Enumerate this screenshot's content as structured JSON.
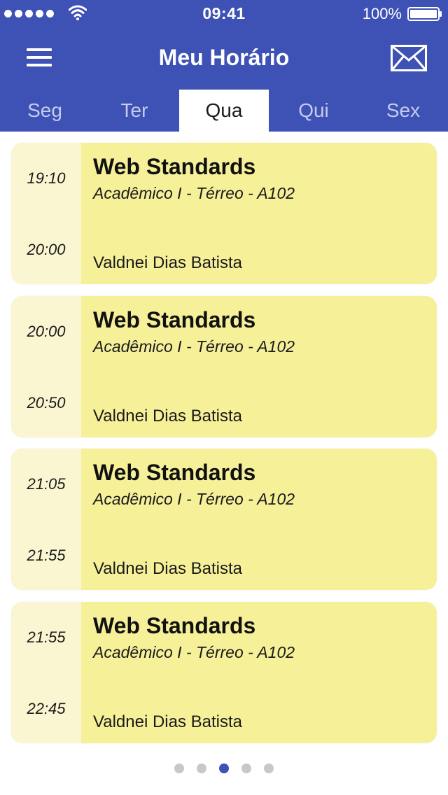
{
  "status_bar": {
    "time": "09:41",
    "battery": "100%"
  },
  "header": {
    "title": "Meu Horário",
    "menu_icon": "hamburger-menu-icon",
    "mail_icon": "envelope-icon"
  },
  "tabs": [
    {
      "label": "Seg",
      "active": false
    },
    {
      "label": "Ter",
      "active": false
    },
    {
      "label": "Qua",
      "active": true
    },
    {
      "label": "Qui",
      "active": false
    },
    {
      "label": "Sex",
      "active": false
    }
  ],
  "classes": [
    {
      "start": "19:10",
      "end": "20:00",
      "title": "Web Standards",
      "location": "Acadêmico I - Térreo - A102",
      "teacher": "Valdnei Dias Batista"
    },
    {
      "start": "20:00",
      "end": "20:50",
      "title": "Web Standards",
      "location": "Acadêmico I - Térreo - A102",
      "teacher": "Valdnei Dias Batista"
    },
    {
      "start": "21:05",
      "end": "21:55",
      "title": "Web Standards",
      "location": "Acadêmico I - Térreo - A102",
      "teacher": "Valdnei Dias Batista"
    },
    {
      "start": "21:55",
      "end": "22:45",
      "title": "Web Standards",
      "location": "Acadêmico I - Térreo - A102",
      "teacher": "Valdnei Dias Batista"
    }
  ],
  "pager": {
    "total": 5,
    "active_index": 2
  },
  "colors": {
    "header": "#3e51b5",
    "card": "#f6f099",
    "card_time": "#faf6d2",
    "pager_active": "#3e51b5",
    "pager_inactive": "#c8c8c8"
  }
}
